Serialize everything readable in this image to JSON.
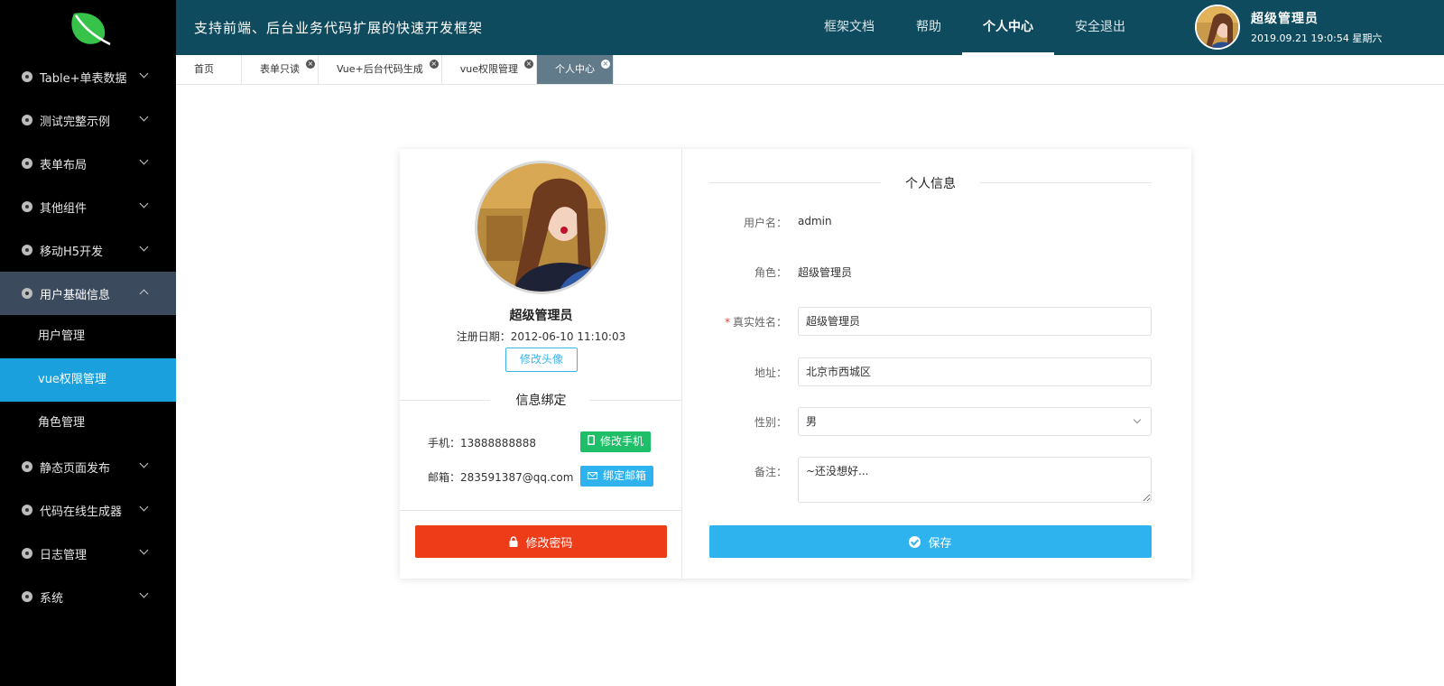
{
  "header": {
    "title": "支持前端、后台业务代码扩展的快速开发框架",
    "nav": [
      "框架文档",
      "帮助",
      "个人中心",
      "安全退出"
    ],
    "nav_active_index": 2,
    "user_name": "超级管理员",
    "datetime": "2019.09.21 19:0:54 星期六"
  },
  "sidebar": {
    "items": [
      {
        "label": "Table+单表数据"
      },
      {
        "label": "测试完整示例"
      },
      {
        "label": "表单布局"
      },
      {
        "label": "其他组件"
      },
      {
        "label": "移动H5开发"
      },
      {
        "label": "用户基础信息",
        "open": true,
        "children": [
          "用户管理",
          "vue权限管理",
          "角色管理"
        ],
        "active_child": 1
      },
      {
        "label": "静态页面发布"
      },
      {
        "label": "代码在线生成器"
      },
      {
        "label": "日志管理"
      },
      {
        "label": "系统"
      }
    ]
  },
  "tabs": [
    {
      "label": "首页",
      "closable": false
    },
    {
      "label": "表单只读",
      "closable": true
    },
    {
      "label": "Vue+后台代码生成",
      "closable": true
    },
    {
      "label": "vue权限管理",
      "closable": true
    },
    {
      "label": "个人中心",
      "closable": true,
      "active": true
    }
  ],
  "profile": {
    "name": "超级管理员",
    "register_date": "注册日期：2012-06-10 11:10:03",
    "change_avatar_label": "修改头像",
    "bind_title": "信息绑定",
    "phone": "手机：13888888888",
    "change_phone_label": "修改手机",
    "email": "邮箱：283591387@qq.com",
    "bind_email_label": "绑定邮箱",
    "change_password_label": "修改密码"
  },
  "info": {
    "title": "个人信息",
    "fields": {
      "username_label": "用户名：",
      "username_value": "admin",
      "role_label": "角色：",
      "role_value": "超级管理员",
      "realname_label": "真实姓名：",
      "realname_value": "超级管理员",
      "address_label": "地址：",
      "address_value": "北京市西城区",
      "gender_label": "性别：",
      "gender_value": "男",
      "remark_label": "备注：",
      "remark_value": "~还没想好..."
    },
    "save_label": "保存"
  },
  "colors": {
    "header_bg": "#0f4b5e",
    "sidebar_bg": "#000000",
    "sidebar_active": "#1aa0dc",
    "danger": "#ee3b18",
    "primary": "#2fb3ee",
    "success": "#1ebf68"
  }
}
